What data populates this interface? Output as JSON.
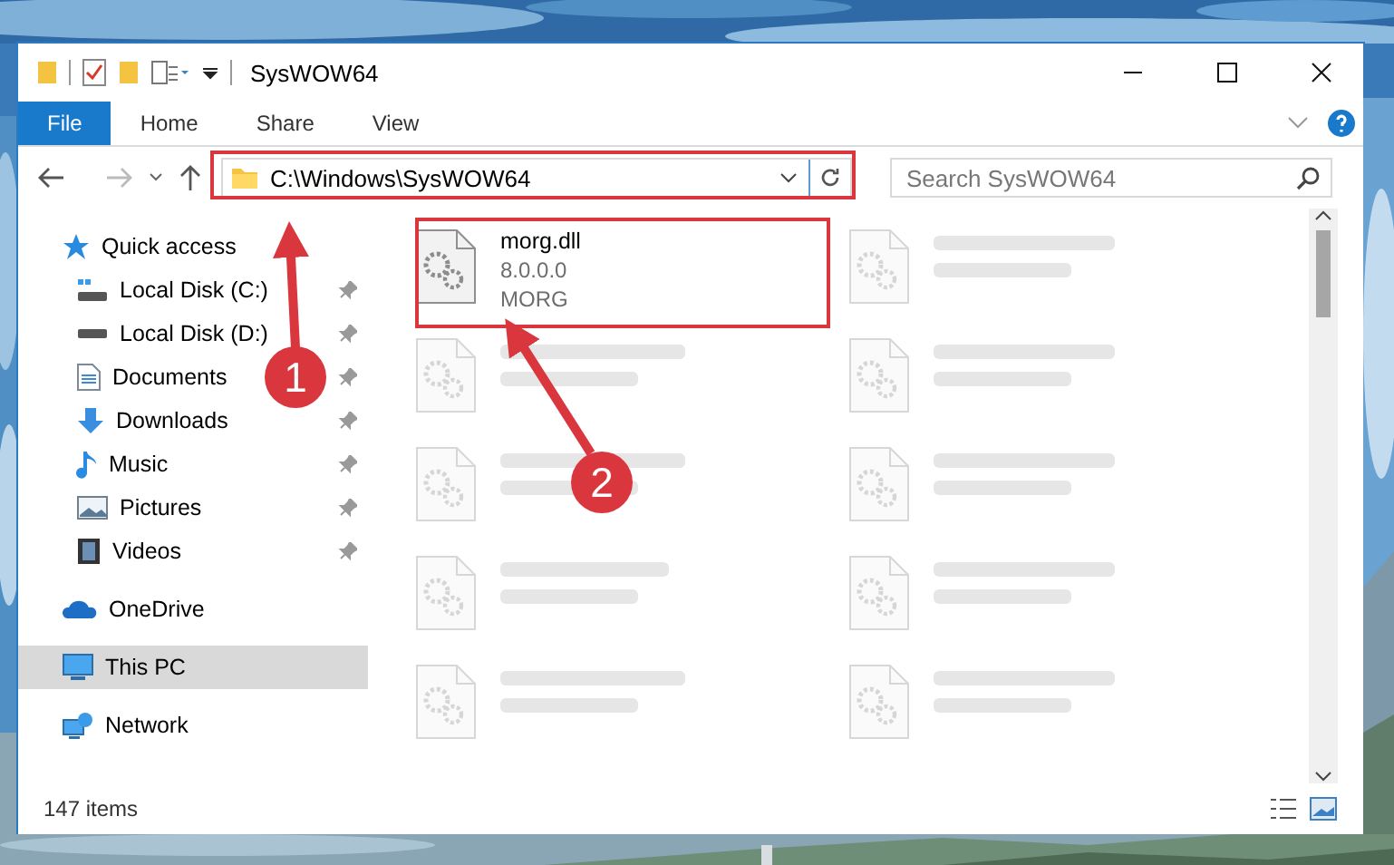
{
  "window": {
    "title": "SysWOW64"
  },
  "ribbon_tabs": [
    {
      "label": "File",
      "selected": true
    },
    {
      "label": "Home",
      "selected": false
    },
    {
      "label": "Share",
      "selected": false
    },
    {
      "label": "View",
      "selected": false
    }
  ],
  "address_bar": {
    "path": "C:\\Windows\\SysWOW64"
  },
  "search": {
    "placeholder": "Search SysWOW64"
  },
  "sidebar": {
    "items": [
      {
        "label": "Quick access",
        "selected": false,
        "children": [
          {
            "label": "Local Disk (C:)",
            "selected": false,
            "pinned": true
          },
          {
            "label": "Local Disk (D:)",
            "selected": false,
            "pinned": true
          },
          {
            "label": "Documents",
            "selected": false,
            "pinned": true
          },
          {
            "label": "Downloads",
            "selected": false,
            "pinned": true
          },
          {
            "label": "Music",
            "selected": false,
            "pinned": true
          },
          {
            "label": "Pictures",
            "selected": false,
            "pinned": true
          },
          {
            "label": "Videos",
            "selected": false,
            "pinned": true
          }
        ]
      },
      {
        "label": "OneDrive",
        "selected": false
      },
      {
        "label": "This PC",
        "selected": true
      },
      {
        "label": "Network",
        "selected": false
      }
    ]
  },
  "files": [
    {
      "name": "morg.dll",
      "details": [
        "8.0.0.0",
        "MORG"
      ],
      "blurred": false
    },
    {
      "blurred": true
    },
    {
      "blurred": true
    },
    {
      "blurred": true
    },
    {
      "blurred": true
    },
    {
      "blurred": true
    },
    {
      "blurred": true
    },
    {
      "blurred": true
    },
    {
      "blurred": true
    },
    {
      "blurred": true
    }
  ],
  "status_bar": {
    "item_count": "147 items"
  },
  "annotations": [
    {
      "number": "1"
    },
    {
      "number": "2"
    }
  ]
}
